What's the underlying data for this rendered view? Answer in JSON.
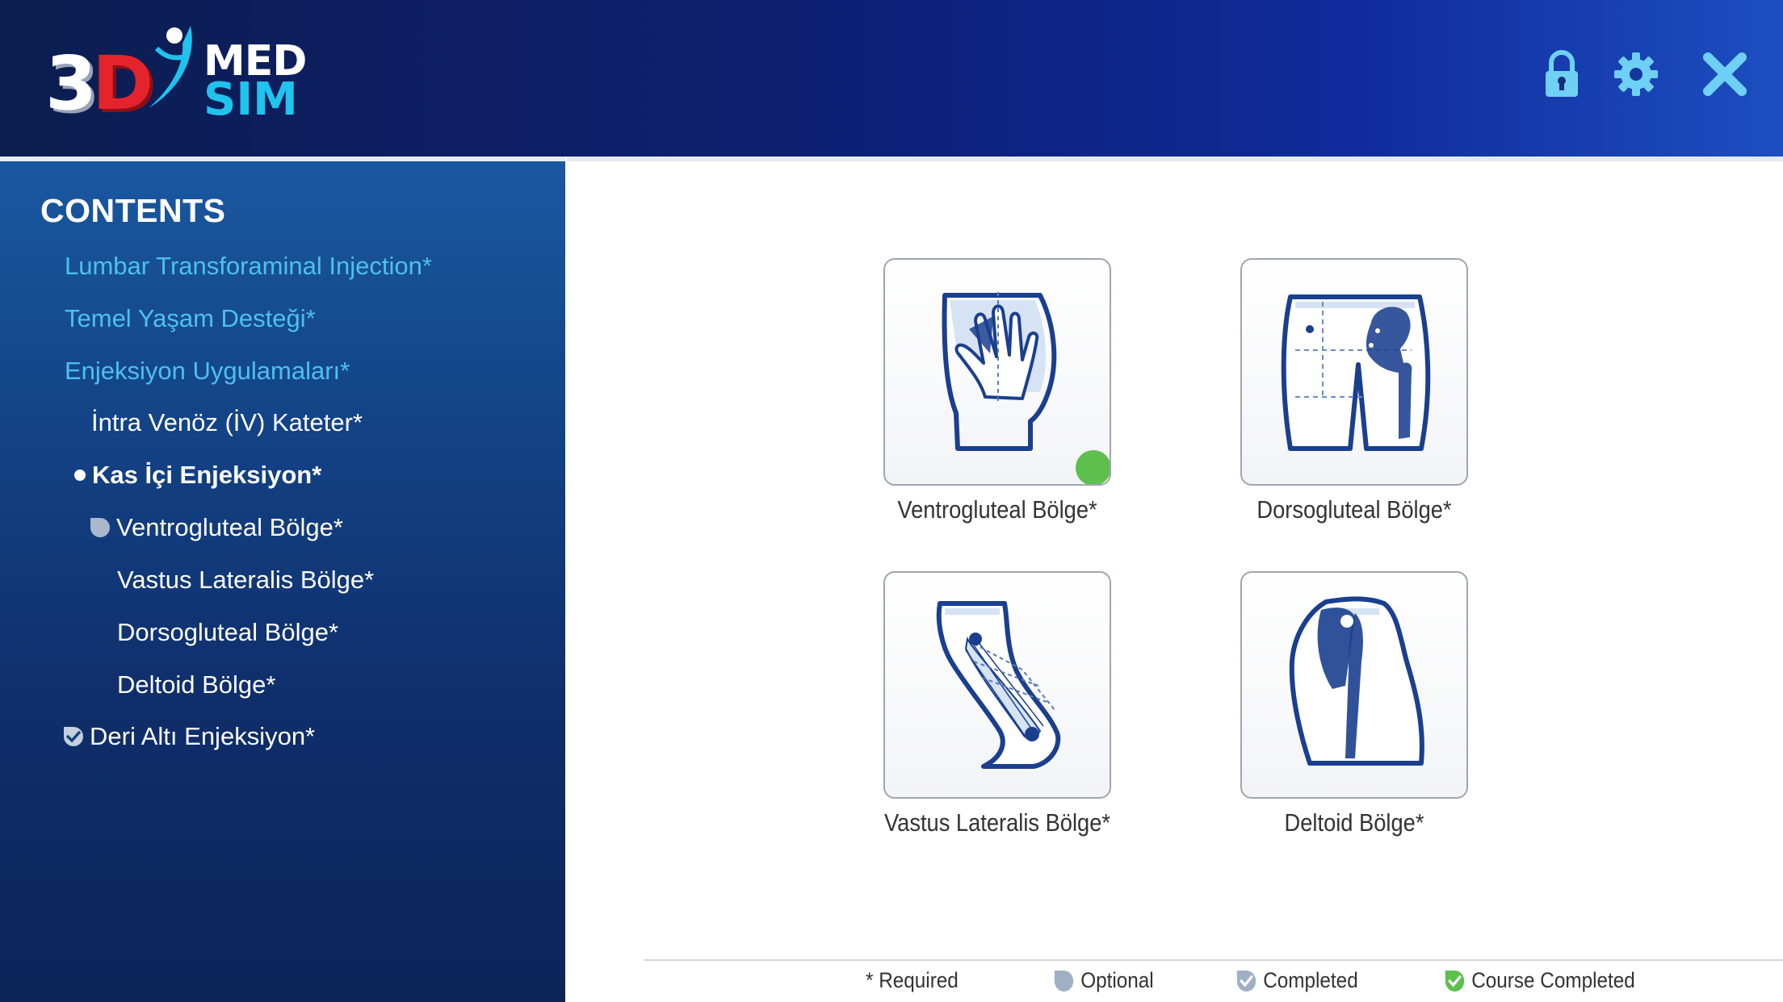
{
  "app": {
    "logo": {
      "part1": "3",
      "part2": "D",
      "part3": "MED",
      "part4": "SIM"
    },
    "colors": {
      "header_dark": "#0b1e50",
      "header_light": "#1d4ec0",
      "link": "#4cc0f0",
      "accent_red": "#e5232c",
      "accent_cyan": "#1fc3ee",
      "completed_green": "#5dbf4c",
      "optional_gray": "#9fb0c6"
    },
    "header_icons": [
      "lock-icon",
      "gear-icon",
      "close-icon"
    ]
  },
  "sidebar": {
    "title": "CONTENTS",
    "items": [
      {
        "label": "Lumbar Transforaminal Injection*",
        "level": 0,
        "style": "link",
        "marker": "none"
      },
      {
        "label": "Temel Yaşam Desteği*",
        "level": 0,
        "style": "link",
        "marker": "none"
      },
      {
        "label": "Enjeksiyon Uygulamaları*",
        "level": 0,
        "style": "link",
        "marker": "none"
      },
      {
        "label": "İntra Venöz (İV) Kateter*",
        "level": 1,
        "style": "white",
        "marker": "none"
      },
      {
        "label": "Kas İçi Enjeksiyon*",
        "level": 1,
        "style": "white-bold",
        "marker": "current-dot"
      },
      {
        "label": "Ventrogluteal Bölge*",
        "level": 2,
        "style": "white",
        "marker": "optional-icon"
      },
      {
        "label": "Vastus Lateralis Bölge*",
        "level": 2,
        "style": "white",
        "marker": "none"
      },
      {
        "label": "Dorsogluteal Bölge*",
        "level": 2,
        "style": "white",
        "marker": "none"
      },
      {
        "label": "Deltoid Bölge*",
        "level": 2,
        "style": "white",
        "marker": "none"
      },
      {
        "label": "Deri Altı Enjeksiyon*",
        "level": 1,
        "style": "white",
        "marker": "completed-icon"
      }
    ]
  },
  "main": {
    "tiles": [
      {
        "label": "Ventrogluteal Bölge*",
        "icon": "ventrogluteal-hip-icon",
        "status": "completed"
      },
      {
        "label": "Dorsogluteal Bölge*",
        "icon": "dorsogluteal-buttocks-icon",
        "status": "none"
      },
      {
        "label": "Vastus Lateralis Bölge*",
        "icon": "vastus-lateralis-thigh-icon",
        "status": "none"
      },
      {
        "label": "Deltoid Bölge*",
        "icon": "deltoid-shoulder-icon",
        "status": "none"
      }
    ]
  },
  "legend": {
    "required": "* Required",
    "optional": "Optional",
    "completed": "Completed",
    "course_completed": "Course Completed"
  }
}
